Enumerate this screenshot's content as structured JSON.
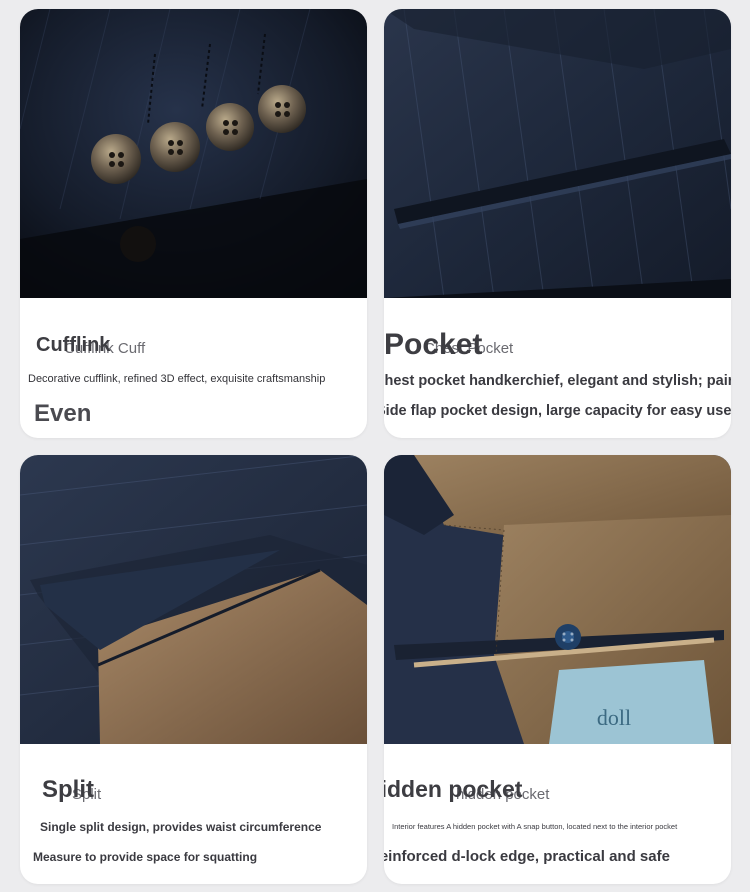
{
  "cards": [
    {
      "title": "Cufflink",
      "ghost": "Cufflink Cuff",
      "lines": [
        "Decorative cufflink, refined 3D effect, exquisite craftsmanship",
        "Even"
      ],
      "icon": "sleeve-buttons"
    },
    {
      "title": "Pocket",
      "ghost": "Chest Pocket",
      "lines": [
        "Chest pocket handkerchief, elegant and stylish; pair",
        "Side flap pocket design, large capacity for easy use"
      ],
      "icon": "flap-pocket"
    },
    {
      "title": "Split",
      "ghost": "Split",
      "lines": [
        "Single split design, provides waist circumference",
        "Measure to provide space for squatting"
      ],
      "icon": "back-vent"
    },
    {
      "title": "Hidden pocket",
      "ghost": "hidden pocket",
      "lines": [
        "Interior features A hidden pocket with A snap button, located next to the interior pocket",
        "Reinforced d-lock edge, practical and safe"
      ],
      "label": "doll",
      "icon": "interior-pocket"
    }
  ],
  "colors": {
    "fabric": "#1f2a3d",
    "lining": "#8a6a4a",
    "background": "#ececee"
  }
}
